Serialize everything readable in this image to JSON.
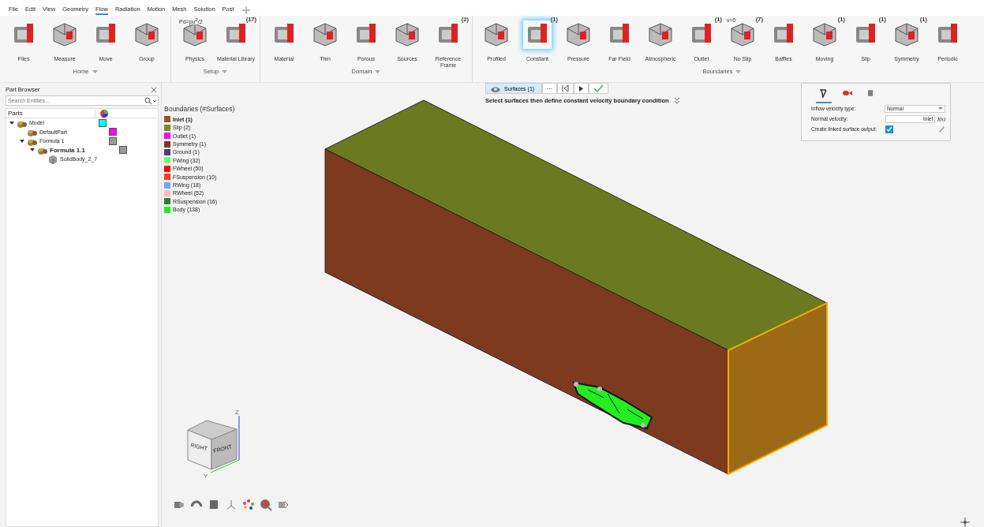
{
  "menu": [
    {
      "label": "File",
      "selected": false
    },
    {
      "label": "Edit",
      "selected": false
    },
    {
      "label": "View",
      "selected": false
    },
    {
      "label": "Geometry",
      "selected": false
    },
    {
      "label": "Flow",
      "selected": true
    },
    {
      "label": "Radiation",
      "selected": false
    },
    {
      "label": "Motion",
      "selected": false
    },
    {
      "label": "Mesh",
      "selected": false
    },
    {
      "label": "Solution",
      "selected": false
    },
    {
      "label": "Post",
      "selected": false
    }
  ],
  "ribbon": [
    {
      "label": "Home",
      "tools": [
        {
          "label": "Files",
          "selected": false
        },
        {
          "label": "Measure",
          "selected": false
        },
        {
          "label": "Move",
          "selected": false
        },
        {
          "label": "Group",
          "selected": false
        }
      ]
    },
    {
      "label": "Setup",
      "tools": [
        {
          "label": "Physics",
          "selected": false,
          "icon_text": "Pd=pu$^{2}$/2"
        },
        {
          "label": "Material Library",
          "selected": false,
          "badge": "(17)"
        }
      ]
    },
    {
      "label": "Domain",
      "tools": [
        {
          "label": "Material",
          "selected": false
        },
        {
          "label": "Thin",
          "selected": false
        },
        {
          "label": "Porous",
          "selected": false
        },
        {
          "label": "Sources",
          "selected": false
        },
        {
          "label": "Reference Frame",
          "selected": false,
          "badge": "(2)"
        }
      ]
    },
    {
      "label": "Boundaries",
      "tools": [
        {
          "label": "Profiled",
          "selected": false
        },
        {
          "label": "Constant",
          "selected": true,
          "badge": "(1)"
        },
        {
          "label": "Pressure",
          "selected": false
        },
        {
          "label": "Far Field",
          "selected": false
        },
        {
          "label": "Atmospheric",
          "selected": false
        },
        {
          "label": "Outlet",
          "selected": false,
          "badge": "(1)"
        },
        {
          "label": "No Slip",
          "selected": false,
          "badge": "(7)",
          "icon_text": "v=0"
        },
        {
          "label": "Baffles",
          "selected": false
        },
        {
          "label": "Moving",
          "selected": false,
          "badge": "(1)"
        },
        {
          "label": "Slip",
          "selected": false,
          "badge": "(1)"
        },
        {
          "label": "Symmetry",
          "selected": false,
          "badge": "(1)"
        },
        {
          "label": "Periodic",
          "selected": false
        }
      ]
    }
  ],
  "part_browser": {
    "title": "Part Browser",
    "search": {
      "placeholder": "Search Entities..."
    },
    "column": "Parts",
    "tree": [
      {
        "label": "Model",
        "color": "#00ffff",
        "active": false,
        "expanded": true,
        "children": [
          {
            "label": "DefaultPart",
            "color": "#ff00ff",
            "active": false
          },
          {
            "label": "Formula 1",
            "color": "#999999",
            "active": false,
            "expanded": true,
            "children": [
              {
                "label": "Formula 1.1",
                "color": "#999999",
                "active": true,
                "expanded": true,
                "children": [
                  {
                    "label": "SolidBody_2_7",
                    "active": false
                  }
                ]
              }
            ]
          }
        ]
      }
    ]
  },
  "legend": {
    "title": "Boundaries (#Surfaces)",
    "items": [
      {
        "label": "Inlet (1)",
        "color": "#8b5a2b",
        "active": true
      },
      {
        "label": "Slip (2)",
        "color": "#7a8a1f",
        "active": false
      },
      {
        "label": "Outlet (1)",
        "color": "#ff00ff",
        "active": false
      },
      {
        "label": "Symmetry (1)",
        "color": "#7a3a1e",
        "active": false
      },
      {
        "label": "Ground (1)",
        "color": "#4b3a8c",
        "active": false
      },
      {
        "label": "FWing (32)",
        "color": "#66ff66",
        "active": false
      },
      {
        "label": "FWheel (50)",
        "color": "#ff0000",
        "active": false
      },
      {
        "label": "FSuspension (10)",
        "color": "#ff3b1a",
        "active": false
      },
      {
        "label": "RWing (18)",
        "color": "#66aaff",
        "active": false
      },
      {
        "label": "RWheel (52)",
        "color": "#ffbbbb",
        "active": false
      },
      {
        "label": "RSuspension (16)",
        "color": "#2e7d32",
        "active": false
      },
      {
        "label": "Body (138)",
        "color": "#22ee22",
        "active": false
      }
    ]
  },
  "selection_bar": {
    "chip": "Surfaces (1)",
    "more": "···",
    "instruction": "Select surfaces then define constant velocity boundary condition"
  },
  "properties": {
    "tabs": [
      {
        "selected": true
      },
      {
        "selected": false
      },
      {
        "selected": false
      }
    ],
    "rows": [
      {
        "kind": "dropdown",
        "label": "Inflow velocity type:",
        "value": "Normal"
      },
      {
        "kind": "field",
        "label": "Normal velocity:",
        "value": "Inlet",
        "suffix": "f(x)"
      },
      {
        "kind": "checkbox",
        "label": "Create linked surface output:",
        "checked": true
      }
    ]
  },
  "view_cube": {
    "faces": [
      "RIGHT",
      "FRONT"
    ],
    "axes": [
      "Z",
      "Y"
    ]
  }
}
